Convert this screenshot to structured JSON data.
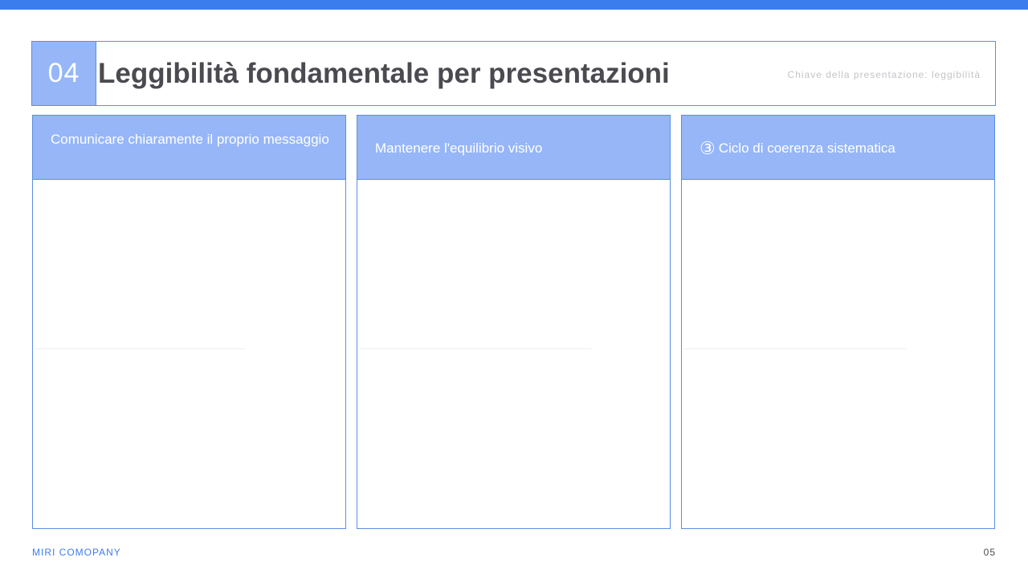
{
  "header": {
    "number": "04",
    "title": "Leggibilità fondamentale per presentazioni",
    "subtitle": "Chiave della presentazione: leggibilità"
  },
  "cards": [
    {
      "title": "Comunicare chiaramente il proprio messaggio"
    },
    {
      "title": "Mantenere l'equilibrio visivo"
    },
    {
      "number": "③",
      "title": "Ciclo di coerenza sistematica"
    }
  ],
  "footer": {
    "brand": "MIRI COMOPANY",
    "page": "05"
  },
  "colors": {
    "accent": "#3b7ded",
    "card_header": "#96b6f7",
    "border": "#5b8fe0",
    "title_text": "#4a4a50"
  }
}
